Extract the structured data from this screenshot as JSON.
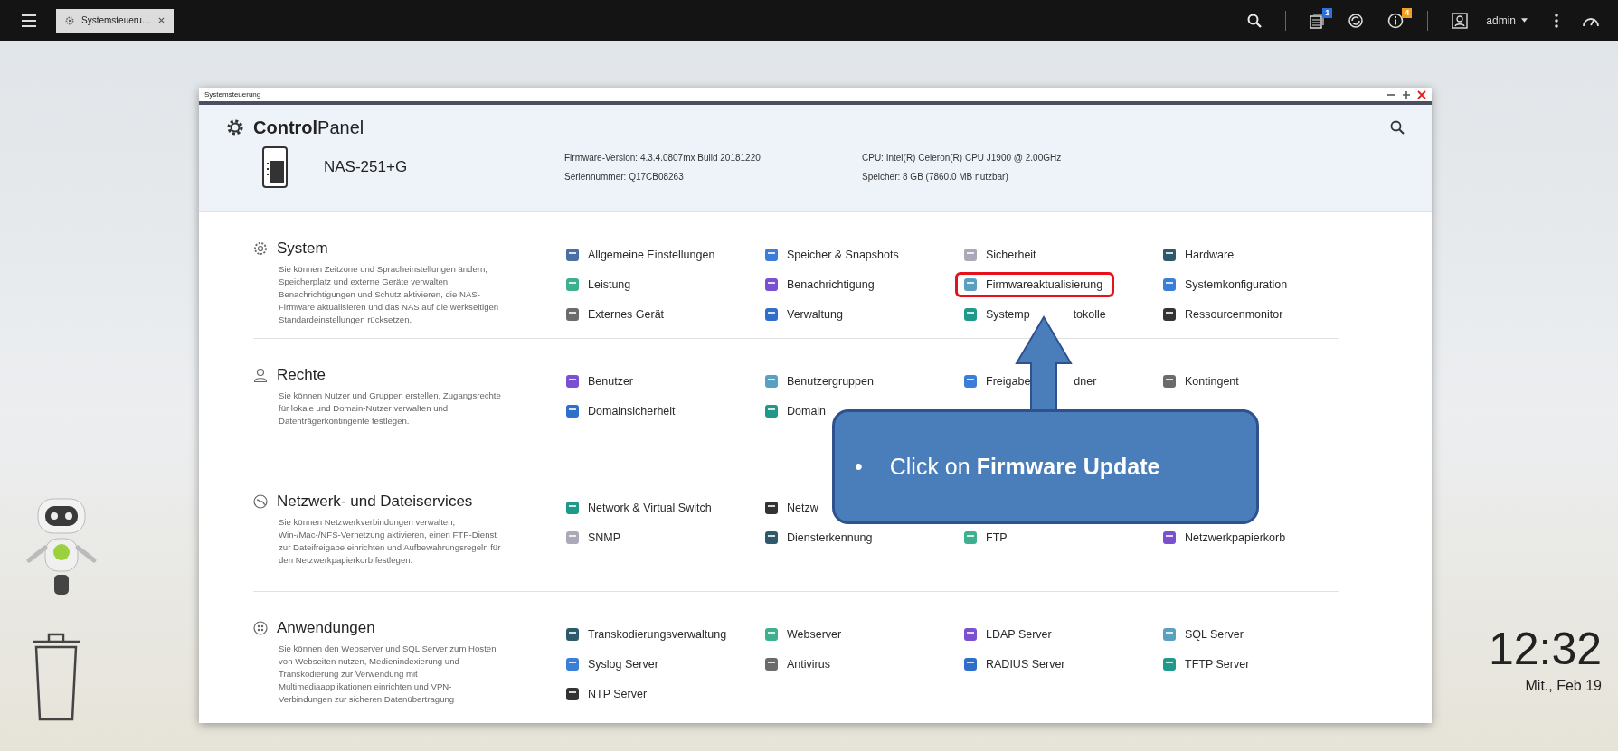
{
  "top_bar": {
    "tab": {
      "label": "Systemsteueru…",
      "selected": true
    },
    "notification_badge": "1",
    "info_badge": "4",
    "user": "admin"
  },
  "window": {
    "title": "Systemsteuerung",
    "app_title": "**Control**Panel"
  },
  "device": {
    "name": "NAS-251+G",
    "info": [
      "Firmware-Version:  4.3.4.0807mx Build 20181220",
      "CPU:  Intel(R) Celeron(R) CPU J1900 @ 2.00GHz",
      "Seriennummer:  Q17CB08263",
      "Speicher:  8 GB (7860.0 MB nutzbar)"
    ]
  },
  "sections": [
    {
      "kind": "system",
      "title": "System",
      "description": "Sie können Zeitzone und Spracheinstellungen ändern, Speicherplatz und externe Geräte verwalten, Benachrichtigungen und Schutz aktivieren, die NAS-Firmware aktualisieren und das NAS auf die werkseitigen Standardeinstellungen rücksetzen.",
      "rows": [
        [
          {
            "label": "Allgemeine Einstellungen",
            "highlighted": false
          },
          {
            "label": "Speicher & Snapshots",
            "highlighted": false
          },
          {
            "label": "Sicherheit",
            "highlighted": false
          },
          {
            "label": "Hardware",
            "highlighted": false
          }
        ],
        [
          {
            "label": "Leistung",
            "highlighted": false
          },
          {
            "label": "Benachrichtigung",
            "highlighted": false
          },
          {
            "label": "Firmwareaktualisierung",
            "highlighted": true
          },
          {
            "label": "Systemkonfiguration",
            "highlighted": false
          }
        ],
        [
          {
            "label": "Externes Gerät",
            "highlighted": false
          },
          {
            "label": "Verwaltung",
            "highlighted": false
          },
          {
            "label": "Systemp",
            "label_after": "tokolle",
            "highlighted": false
          },
          {
            "label": "Ressourcenmonitor",
            "highlighted": false
          }
        ]
      ]
    },
    {
      "kind": "users",
      "title": "Rechte",
      "description": "Sie können Nutzer und Gruppen erstellen, Zugangsrechte für lokale und Domain-Nutzer verwalten und Datenträgerkontingente festlegen.",
      "rows": [
        [
          {
            "label": "Benutzer",
            "highlighted": false
          },
          {
            "label": "Benutzergruppen",
            "highlighted": false
          },
          {
            "label": "Freigabe",
            "label_after": "dner",
            "highlighted": false
          },
          {
            "label": "Kontingent",
            "highlighted": false
          }
        ],
        [
          {
            "label": "Domainsicherheit",
            "highlighted": false
          },
          {
            "label": "Domain",
            "highlighted": false
          }
        ]
      ]
    },
    {
      "kind": "network",
      "title": "Netzwerk- und Dateiservices",
      "description": "Sie können Netzwerkverbindungen verwalten, Win-/Mac-/NFS-Vernetzung aktivieren, einen FTP-Dienst zur Dateifreigabe einrichten und Aufbewahrungsregeln für den Netzwerkpapierkorb festlegen.",
      "rows": [
        [
          {
            "label": "Network & Virtual Switch",
            "highlighted": false
          },
          {
            "label": "Netzw",
            "highlighted": false
          }
        ],
        [
          {
            "label": "SNMP",
            "highlighted": false
          },
          {
            "label": "Diensterkennung",
            "highlighted": false
          },
          {
            "label": "FTP",
            "highlighted": false
          },
          {
            "label": "Netzwerkpapierkorb",
            "highlighted": false
          }
        ]
      ]
    },
    {
      "kind": "apps",
      "title": "Anwendungen",
      "description": "Sie können den Webserver und SQL Server zum Hosten von Webseiten nutzen, Medienindexierung und Transkodierung zur Verwendung mit Multimediaapplikationen einrichten und VPN-Verbindungen zur sicheren Datenübertragung",
      "rows": [
        [
          {
            "label": "Transkodierungsverwaltung",
            "highlighted": false
          },
          {
            "label": "Webserver",
            "highlighted": false
          },
          {
            "label": "LDAP Server",
            "highlighted": false
          },
          {
            "label": "SQL Server",
            "highlighted": false
          }
        ],
        [
          {
            "label": "Syslog Server",
            "highlighted": false
          },
          {
            "label": "Antivirus",
            "highlighted": false
          },
          {
            "label": "RADIUS Server",
            "highlighted": false
          },
          {
            "label": "TFTP Server",
            "highlighted": false
          }
        ],
        [
          {
            "label": "NTP Server",
            "highlighted": false
          }
        ]
      ]
    }
  ],
  "callout": {
    "bullet": "•",
    "text": "Click on **Firmware Update**"
  },
  "clock": {
    "time": "12:32",
    "date": "Mit., Feb 19"
  }
}
